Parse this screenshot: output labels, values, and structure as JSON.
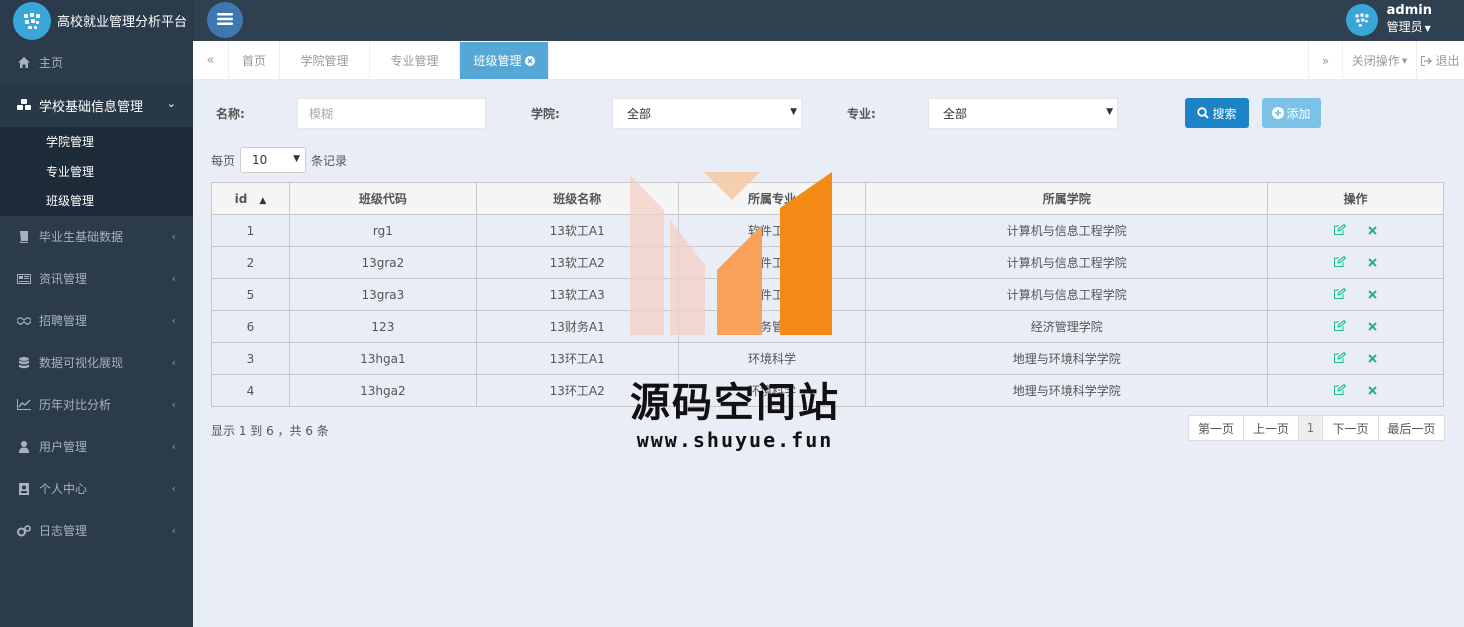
{
  "app": {
    "title": "高校就业管理分析平台"
  },
  "user": {
    "name": "admin",
    "role": "管理员"
  },
  "sidebar": {
    "items": [
      {
        "label": "主页",
        "icon": "home-icon"
      },
      {
        "label": "学校基础信息管理",
        "icon": "cubes-icon",
        "active": true,
        "children": [
          "学院管理",
          "专业管理",
          "班级管理"
        ]
      },
      {
        "label": "毕业生基础数据",
        "icon": "book-icon"
      },
      {
        "label": "资讯管理",
        "icon": "newspaper-icon"
      },
      {
        "label": "招聘管理",
        "icon": "handshake-icon"
      },
      {
        "label": "数据可视化展现",
        "icon": "database-icon"
      },
      {
        "label": "历年对比分析",
        "icon": "line-chart-icon"
      },
      {
        "label": "用户管理",
        "icon": "user-icon"
      },
      {
        "label": "个人中心",
        "icon": "id-card-icon"
      },
      {
        "label": "日志管理",
        "icon": "gears-icon"
      }
    ]
  },
  "tabs": {
    "prev": "«",
    "next": "»",
    "items": [
      "首页",
      "学院管理",
      "专业管理",
      "班级管理"
    ],
    "active": "班级管理",
    "close_ops": "关闭操作",
    "logout": "退出"
  },
  "filters": {
    "name_label": "名称:",
    "name_placeholder": "模糊",
    "college_label": "学院:",
    "college_value": "全部",
    "major_label": "专业:",
    "major_value": "全部",
    "search_label": "搜索",
    "add_label": "添加"
  },
  "pagination": {
    "per_page_prefix": "每页",
    "per_page_value": "10",
    "per_page_suffix": "条记录",
    "summary": "显示 1 到 6 ，共 6 条",
    "first": "第一页",
    "prev": "上一页",
    "current": "1",
    "next": "下一页",
    "last": "最后一页"
  },
  "table": {
    "columns": [
      "id",
      "班级代码",
      "班级名称",
      "所属专业",
      "所属学院",
      "操作"
    ],
    "rows": [
      {
        "id": "1",
        "code": "rg1",
        "name": "13软工A1",
        "major": "软件工程",
        "college": "计算机与信息工程学院"
      },
      {
        "id": "2",
        "code": "13gra2",
        "name": "13软工A2",
        "major": "软件工程",
        "college": "计算机与信息工程学院"
      },
      {
        "id": "5",
        "code": "13gra3",
        "name": "13软工A3",
        "major": "软件工程",
        "college": "计算机与信息工程学院"
      },
      {
        "id": "6",
        "code": "123",
        "name": "13财务A1",
        "major": "财务管理",
        "college": "经济管理学院"
      },
      {
        "id": "3",
        "code": "13hga1",
        "name": "13环工A1",
        "major": "环境科学",
        "college": "地理与环境科学学院"
      },
      {
        "id": "4",
        "code": "13hga2",
        "name": "13环工A2",
        "major": "环境科学",
        "college": "地理与环境科学学院"
      }
    ]
  },
  "watermark": {
    "title": "源码空间站",
    "url": "www.shuyue.fun"
  },
  "colors": {
    "sidebar_bg": "#2b3b4c",
    "header_bg": "#2f4050",
    "active_tab": "#55a8d6",
    "search_btn": "#1c84c6",
    "add_btn": "#7cc2e8",
    "action_icon": "#1ab394",
    "content_bg": "#e9edf5"
  }
}
